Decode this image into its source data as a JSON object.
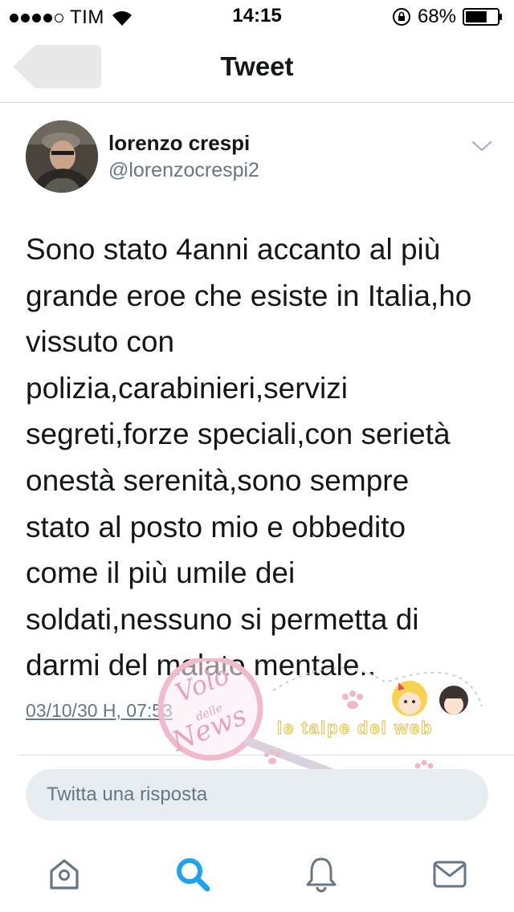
{
  "status_bar": {
    "carrier": "TIM",
    "time": "14:15",
    "battery_percent": "68%",
    "battery_level": 0.68,
    "signal_bars_filled": 4,
    "signal_bars_total": 5
  },
  "nav": {
    "title": "Tweet",
    "back_icon": "back-arrow-icon"
  },
  "tweet": {
    "author_name": "lorenzo crespi",
    "author_handle": "@lorenzocrespi2",
    "text_lines": [
      "Sono stato 4anni accanto al più",
      "grande eroe che esiste in Italia,ho",
      "vissuto con",
      "polizia,carabinieri,servizi",
      "segreti,forze speciali,con serietà",
      "onestà serenità,sono sempre",
      "stato al posto mio e obbedito",
      "come il più umile dei",
      "soldati,nessuno si permetta di",
      "darmi del malato mentale.."
    ],
    "timestamp": "03/10/30 H, 07:53"
  },
  "watermark": {
    "logo_text_1": "Volo",
    "logo_text_2": "delle",
    "logo_text_3": "News",
    "banner_text": "le talpe del web"
  },
  "reply": {
    "placeholder": "Twitta una risposta"
  },
  "tab_bar": {
    "items": [
      "home-icon",
      "search-icon",
      "notifications-icon",
      "messages-icon"
    ],
    "active": "search-icon",
    "accent_color": "#1da1f2",
    "icon_color": "#657786"
  }
}
